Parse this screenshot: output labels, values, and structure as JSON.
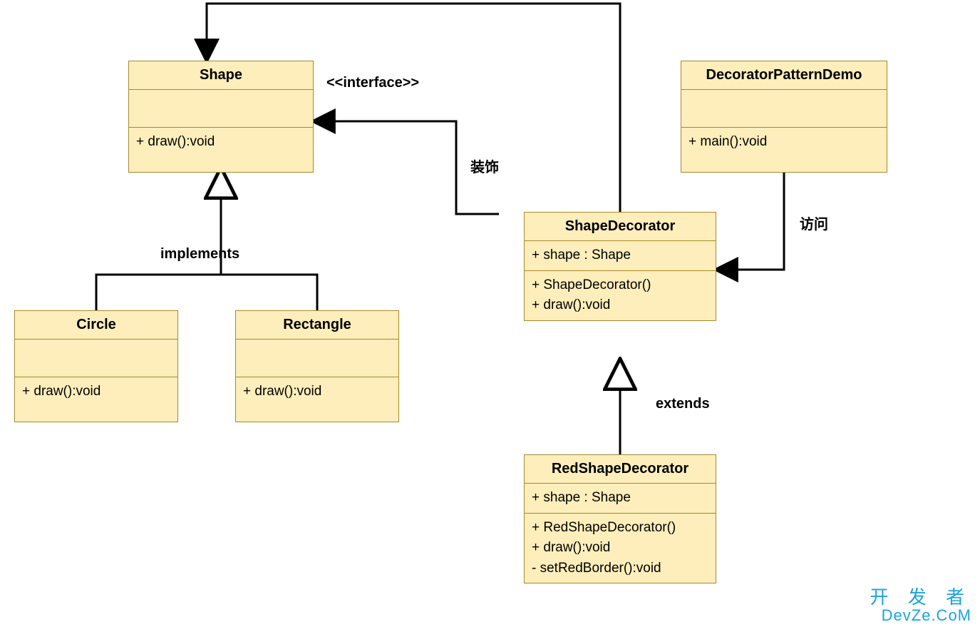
{
  "stereo_interface": "<<interface>>",
  "labels": {
    "implements": "implements",
    "extends": "extends",
    "decorate": "装饰",
    "access": "访问"
  },
  "classes": {
    "shape": {
      "name": "Shape",
      "attrs": "",
      "ops": "+ draw():void"
    },
    "circle": {
      "name": "Circle",
      "attrs": "",
      "ops": "+ draw():void"
    },
    "rectangle": {
      "name": "Rectangle",
      "attrs": "",
      "ops": "+ draw():void"
    },
    "shape_decorator": {
      "name": "ShapeDecorator",
      "attrs": "+ shape : Shape",
      "ops1": "+ ShapeDecorator()",
      "ops2": "+ draw():void"
    },
    "red_shape_decorator": {
      "name": "RedShapeDecorator",
      "attrs": "+ shape : Shape",
      "ops1": "+ RedShapeDecorator()",
      "ops2": "+ draw():void",
      "ops3": "- setRedBorder():void"
    },
    "demo": {
      "name": "DecoratorPatternDemo",
      "attrs": "",
      "ops": "+ main():void"
    }
  },
  "watermark": {
    "cn": "开 发 者",
    "en": "DevZe.CoM"
  }
}
